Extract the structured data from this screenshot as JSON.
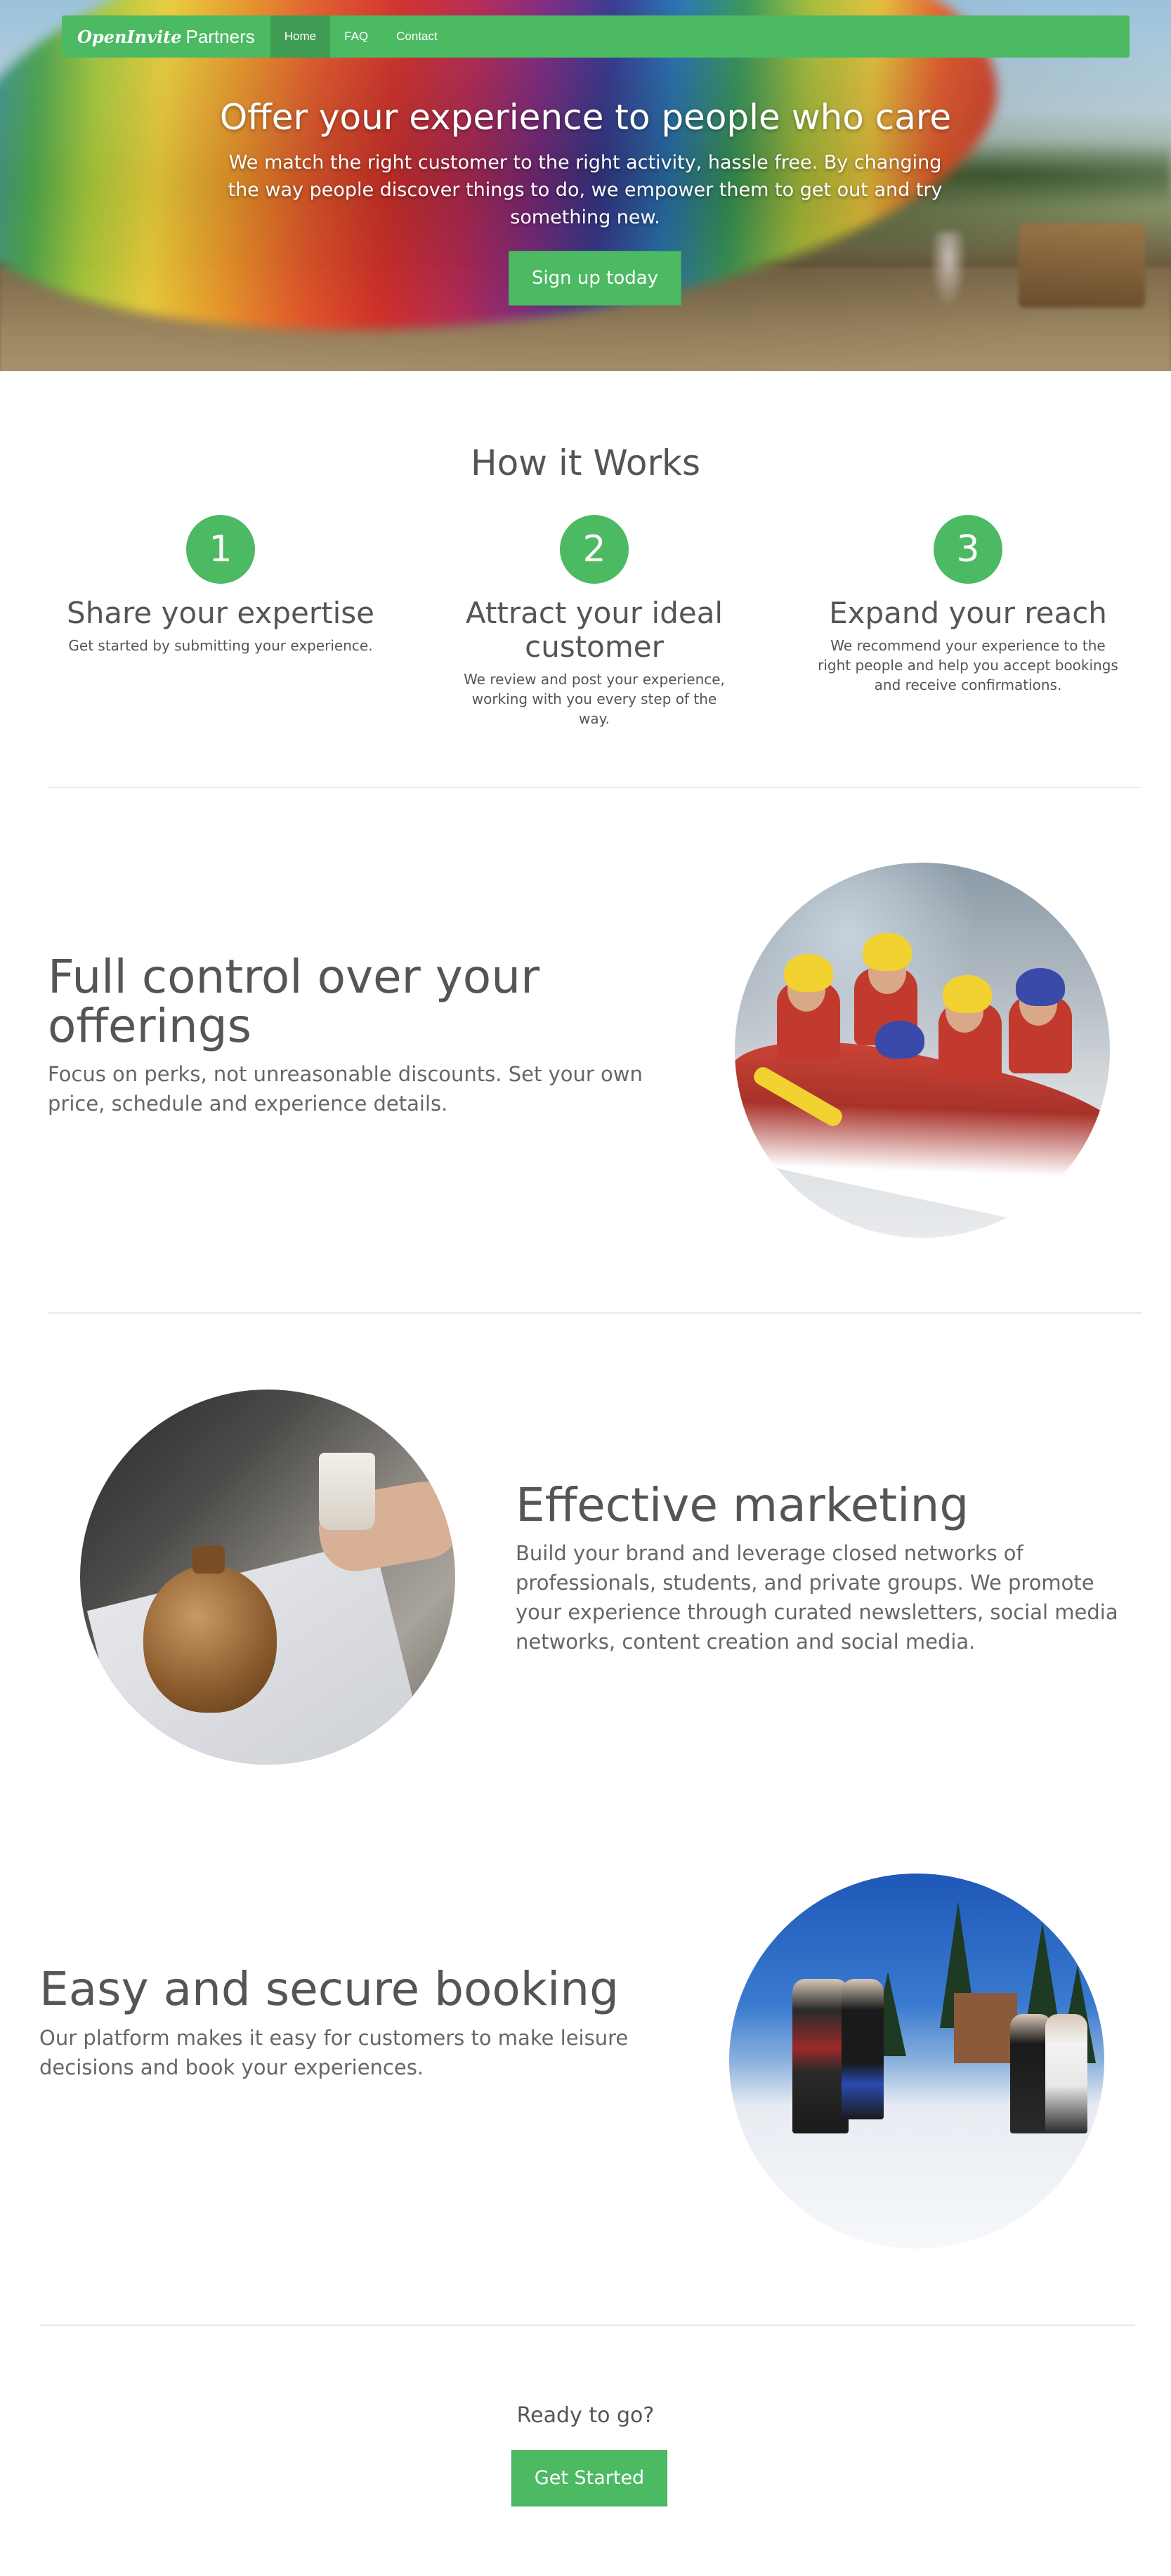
{
  "nav": {
    "brand_primary": "OpenInvite",
    "brand_secondary": "Partners",
    "items": [
      {
        "label": "Home",
        "active": true
      },
      {
        "label": "FAQ",
        "active": false
      },
      {
        "label": "Contact",
        "active": false
      }
    ]
  },
  "hero": {
    "title": "Offer your experience to people who care",
    "subtitle": "We match the right customer to the right activity, hassle free. By changing the way people discover things to do, we empower them to get out and try something new.",
    "cta_label": "Sign up today"
  },
  "how_it_works": {
    "title": "How it Works",
    "steps": [
      {
        "number": "1",
        "title": "Share your expertise",
        "text": "Get started by submitting your experience."
      },
      {
        "number": "2",
        "title": "Attract your ideal customer",
        "text": "We review and post your experience, working with you every step of the way."
      },
      {
        "number": "3",
        "title": "Expand your reach",
        "text": "We recommend your experience to the right people and help you accept bookings and receive confirmations."
      }
    ]
  },
  "features": [
    {
      "title": "Full control over your offerings",
      "text": "Focus on perks, not unreasonable discounts. Set your own price, schedule and experience details.",
      "image": "rafting-photo"
    },
    {
      "title": "Effective marketing",
      "text": "Build your brand and leverage closed networks of professionals, students, and private groups. We promote your experience through curated newsletters, social media networks, content creation and social media.",
      "image": "pottery-photo"
    },
    {
      "title": "Easy and secure booking",
      "text": "Our platform makes it easy for customers to make leisure decisions and book your experiences.",
      "image": "skiing-photo"
    }
  ],
  "cta": {
    "text": "Ready to go?",
    "button_label": "Get Started"
  },
  "colors": {
    "accent": "#4cb963",
    "accent_active": "#3f9d53",
    "text": "#555555"
  }
}
